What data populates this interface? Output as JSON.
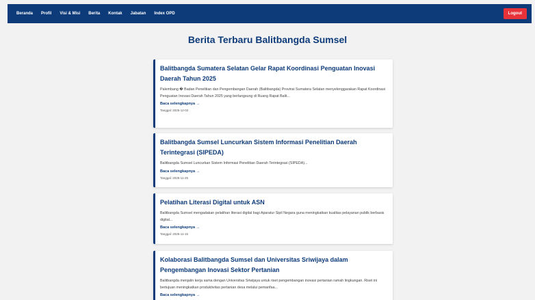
{
  "nav": {
    "items": [
      "Beranda",
      "Profil",
      "Visi & Misi",
      "Berita",
      "Kontak",
      "Jabatan",
      "Index OPD"
    ],
    "logout_label": "Logout"
  },
  "page": {
    "title": "Berita Terbaru Balitbangda Sumsel"
  },
  "news": [
    {
      "title": "Balitbangda Sumatera Selatan Gelar Rapat Koordinasi Penguatan Inovasi Daerah Tahun 2025",
      "excerpt": "Palembang � Badan Penelitian dan Pengembangan Daerah (Balitbangda) Provinsi Sumatera Selatan menyelenggarakan Rapat Koordinasi Penguatan Inovasi Daerah Tahun 2025 yang berlangsung di Ruang Rapat Balit...",
      "link": "Baca selengkapnya →",
      "date": "Tanggal: 2025-12-02"
    },
    {
      "title": "Balitbangda Sumsel Luncurkan Sistem Informasi Penelitian Daerah Terintegrasi (SIPEDA)",
      "excerpt": "Balitbangda Sumsel Luncurkan Sistem Informasi Penelitian Daerah Terintegrasi (SIPEDA)...",
      "link": "Baca selengkapnya →",
      "date": "Tanggal: 2025-11-25"
    },
    {
      "title": "Pelatihan Literasi Digital untuk ASN",
      "excerpt": "Balitbangda Sumsel mengadakan pelatihan literasi digital bagi Aparatur Sipil Negara guna meningkatkan kualitas pelayanan publik berbasis digital...",
      "link": "Baca selengkapnya →",
      "date": "Tanggal: 2025-11-15"
    },
    {
      "title": "Kolaborasi Balitbangda Sumsel dan Universitas Sriwijaya dalam Pengembangan Inovasi Sektor Pertanian",
      "excerpt": "Balitbangda menjalin kerja sama dengan Universitas Sriwijaya untuk riset pengembangan inovasi pertanian ramah lingkungan. Riset ini bertujuan meningkatkan produktivitas pertanian desa melalui pemanfaa...",
      "link": "Baca selengkapnya →",
      "date": ""
    }
  ],
  "colors": {
    "navbar": "#0d3b7a",
    "logout": "#e8323a",
    "background": "#f2f2f2",
    "accent": "#0d3b7a"
  }
}
